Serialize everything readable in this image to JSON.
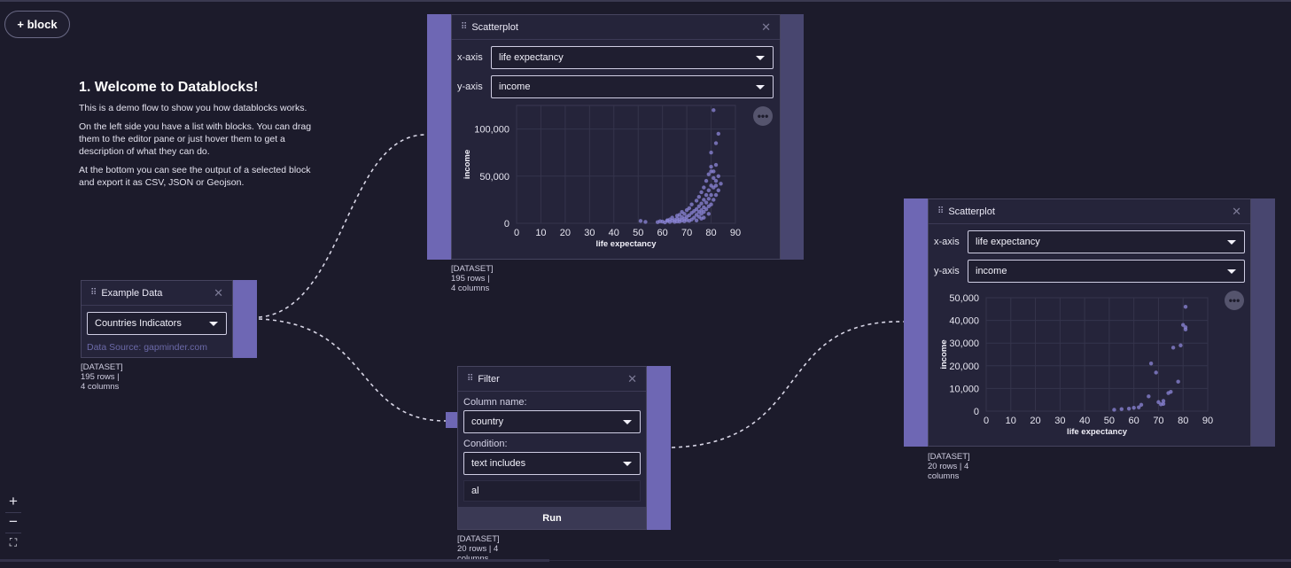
{
  "toolbar": {
    "add_block_label": "+ block"
  },
  "welcome": {
    "title": "1. Welcome to Datablocks!",
    "p1": "This is a demo flow to show you how datablocks works.",
    "p2": "On the left side you have a list with blocks. You can drag them to the editor pane or just hover them to get a description of what they can do.",
    "p3": "At the bottom you can see the output of a selected block and export it as CSV, JSON or Geojson."
  },
  "example_data": {
    "title": "Example Data",
    "selected": "Countries Indicators",
    "source": "Data Source: gapminder.com",
    "footer": "[DATASET] 195 rows | 4 columns"
  },
  "scatter1": {
    "title": "Scatterplot",
    "x_label": "x-axis",
    "y_label": "y-axis",
    "x_value": "life expectancy",
    "y_value": "income",
    "footer": "[DATASET] 195 rows | 4 columns"
  },
  "filter": {
    "title": "Filter",
    "column_label": "Column name:",
    "column_value": "country",
    "condition_label": "Condition:",
    "condition_value": "text includes",
    "text_value": "al",
    "run_label": "Run",
    "footer": "[DATASET] 20 rows | 4 columns"
  },
  "scatter2": {
    "title": "Scatterplot",
    "x_label": "x-axis",
    "y_label": "y-axis",
    "x_value": "life expectancy",
    "y_value": "income",
    "footer": "[DATASET] 20 rows | 4 columns"
  },
  "icons": {
    "grip": "drag-grip-icon",
    "close": "close-icon",
    "caret": "chevron-down-icon",
    "more": "more-horizontal-icon",
    "zoom_in": "plus-icon",
    "zoom_out": "minus-icon",
    "fit": "fit-view-icon"
  },
  "colors": {
    "background": "#1c1b2b",
    "accent": "#6e67b4",
    "point": "#8c86d8"
  },
  "chart_data": [
    {
      "type": "scatter",
      "xlabel": "life expectancy",
      "ylabel": "income",
      "xlim": [
        0,
        90
      ],
      "ylim": [
        0,
        125000
      ],
      "xticks": [
        "0",
        "10",
        "20",
        "30",
        "40",
        "50",
        "60",
        "70",
        "80",
        "90"
      ],
      "yticks": [
        "0",
        "50,000",
        "100,000"
      ],
      "ytick_values": [
        0,
        50000,
        100000
      ],
      "grid": true,
      "points": [
        [
          51,
          2500
        ],
        [
          53,
          1500
        ],
        [
          58,
          1200
        ],
        [
          59,
          2200
        ],
        [
          60,
          1800
        ],
        [
          61,
          1000
        ],
        [
          62,
          2600
        ],
        [
          62,
          3200
        ],
        [
          63,
          1500
        ],
        [
          63,
          4000
        ],
        [
          64,
          2800
        ],
        [
          64,
          6000
        ],
        [
          65,
          1500
        ],
        [
          65,
          3500
        ],
        [
          66,
          2000
        ],
        [
          66,
          5000
        ],
        [
          66,
          8000
        ],
        [
          67,
          1800
        ],
        [
          67,
          4200
        ],
        [
          67,
          9000
        ],
        [
          68,
          3000
        ],
        [
          68,
          6500
        ],
        [
          68,
          12000
        ],
        [
          69,
          2200
        ],
        [
          69,
          5000
        ],
        [
          69,
          10000
        ],
        [
          70,
          3500
        ],
        [
          70,
          7000
        ],
        [
          70,
          14000
        ],
        [
          71,
          2600
        ],
        [
          71,
          8500
        ],
        [
          71,
          16000
        ],
        [
          72,
          4000
        ],
        [
          72,
          11000
        ],
        [
          72,
          20000
        ],
        [
          73,
          6000
        ],
        [
          73,
          13000
        ],
        [
          74,
          3000
        ],
        [
          74,
          9000
        ],
        [
          74,
          15000
        ],
        [
          74,
          24000
        ],
        [
          75,
          7000
        ],
        [
          75,
          12000
        ],
        [
          75,
          18000
        ],
        [
          75,
          28000
        ],
        [
          76,
          5000
        ],
        [
          76,
          10000
        ],
        [
          76,
          14000
        ],
        [
          76,
          21000
        ],
        [
          76,
          33000
        ],
        [
          77,
          6000
        ],
        [
          77,
          12000
        ],
        [
          77,
          17000
        ],
        [
          77,
          25000
        ],
        [
          77,
          38000
        ],
        [
          78,
          15000
        ],
        [
          78,
          22000
        ],
        [
          78,
          30000
        ],
        [
          78,
          45000
        ],
        [
          79,
          10000
        ],
        [
          79,
          18000
        ],
        [
          79,
          26000
        ],
        [
          79,
          35000
        ],
        [
          79,
          52000
        ],
        [
          80,
          20000
        ],
        [
          80,
          30000
        ],
        [
          80,
          40000
        ],
        [
          80,
          60000
        ],
        [
          80,
          75000
        ],
        [
          81,
          25000
        ],
        [
          81,
          38000
        ],
        [
          81,
          48000
        ],
        [
          81,
          55000
        ],
        [
          82,
          30000
        ],
        [
          82,
          45000
        ],
        [
          82,
          62000
        ],
        [
          82,
          85000
        ],
        [
          83,
          35000
        ],
        [
          83,
          50000
        ],
        [
          83,
          95000
        ],
        [
          84,
          42000
        ],
        [
          81,
          120000
        ],
        [
          80,
          55000
        ],
        [
          82,
          40000
        ]
      ]
    },
    {
      "type": "scatter",
      "xlabel": "life expectancy",
      "ylabel": "income",
      "xlim": [
        0,
        90
      ],
      "ylim": [
        0,
        50000
      ],
      "xticks": [
        "0",
        "10",
        "20",
        "30",
        "40",
        "50",
        "60",
        "70",
        "80",
        "90"
      ],
      "yticks": [
        "0",
        "10,000",
        "20,000",
        "30,000",
        "40,000",
        "50,000"
      ],
      "ytick_values": [
        0,
        10000,
        20000,
        30000,
        40000,
        50000
      ],
      "grid": true,
      "points": [
        [
          52,
          600
        ],
        [
          55,
          900
        ],
        [
          58,
          1100
        ],
        [
          60,
          1500
        ],
        [
          62,
          1700
        ],
        [
          63,
          2800
        ],
        [
          66,
          6500
        ],
        [
          67,
          21000
        ],
        [
          69,
          17000
        ],
        [
          70,
          4000
        ],
        [
          71,
          3000
        ],
        [
          72,
          3200
        ],
        [
          74,
          8000
        ],
        [
          75,
          8500
        ],
        [
          76,
          28000
        ],
        [
          78,
          13000
        ],
        [
          79,
          29000
        ],
        [
          80,
          38000
        ],
        [
          81,
          37000
        ],
        [
          81,
          36000
        ],
        [
          81,
          46000
        ],
        [
          72,
          4500
        ]
      ]
    }
  ]
}
